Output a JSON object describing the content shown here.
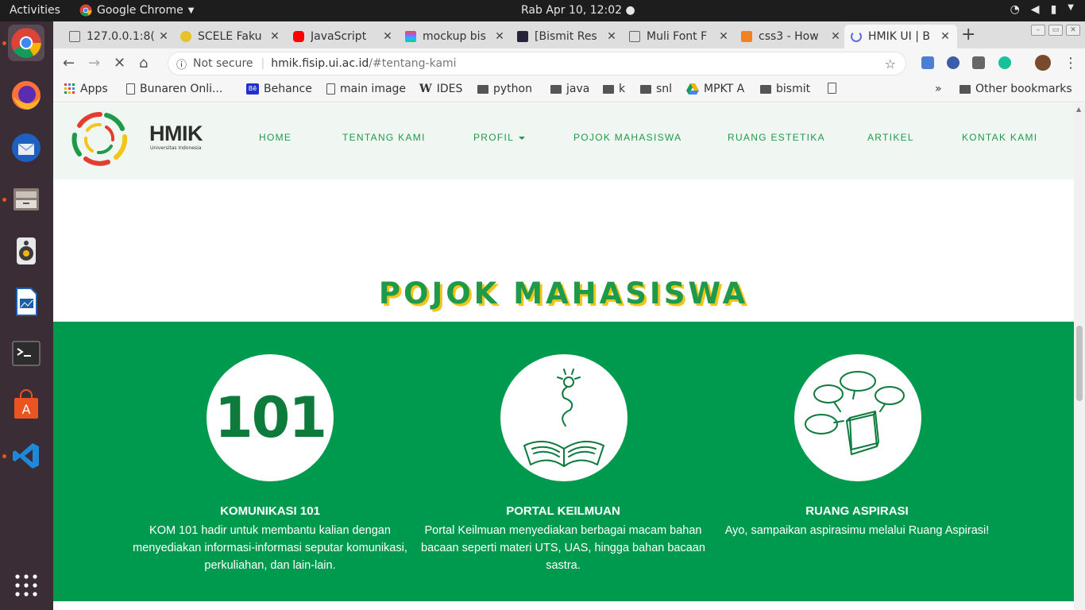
{
  "os": {
    "activities": "Activities",
    "app_name": "Google Chrome",
    "clock": "Rab Apr 10, 12:02 ●"
  },
  "tabs": [
    {
      "title": "127.0.0.1:8(",
      "icon_color": "#666666"
    },
    {
      "title": "SCELE Faku",
      "icon_color": "#e6c229"
    },
    {
      "title": "JavaScript",
      "icon_color": "#ff0000"
    },
    {
      "title": "mockup bis",
      "icon_color": "#a259ff"
    },
    {
      "title": "[Bismit Res",
      "icon_color": "#26233a"
    },
    {
      "title": "Muli Font F",
      "icon_color": "#666666"
    },
    {
      "title": "css3 - How",
      "icon_color": "#f48024"
    },
    {
      "title": "HMIK UI | B",
      "icon_color": "#5b6ee1"
    }
  ],
  "address": {
    "security": "Not secure",
    "host": "hmik.fisip.ui.ac.id",
    "path": "/#tentang-kami"
  },
  "bookmarks": [
    {
      "label": "Apps",
      "kind": "apps"
    },
    {
      "label": "Bunaren Onli...",
      "kind": "page"
    },
    {
      "label": "Behance",
      "kind": "behance"
    },
    {
      "label": "main image",
      "kind": "page"
    },
    {
      "label": "IDES",
      "kind": "wiki"
    },
    {
      "label": "python",
      "kind": "folder"
    },
    {
      "label": "java",
      "kind": "folder"
    },
    {
      "label": "k",
      "kind": "folder"
    },
    {
      "label": "snl",
      "kind": "folder"
    },
    {
      "label": "MPKT A",
      "kind": "drive"
    },
    {
      "label": "bismit",
      "kind": "folder"
    },
    {
      "label": "",
      "kind": "page"
    }
  ],
  "bookmarks_more": "»",
  "other_bookmarks": "Other bookmarks",
  "site": {
    "logo_text": "HMIK",
    "logo_subtext": "Universitas Indonesia",
    "menu": [
      "HOME",
      "TENTANG KAMI",
      "PROFIL",
      "POJOK MAHASISWA",
      "RUANG ESTETIKA",
      "ARTIKEL",
      "KONTAK KAMI"
    ],
    "section_title": "POJOK MAHASISWA",
    "brand_green": "#009a4e",
    "accent_yellow": "#f3c518",
    "cards": [
      {
        "icon_text": "101",
        "title": "KOMUNIKASI 101",
        "desc": "KOM 101 hadir untuk membantu kalian dengan menyediakan informasi-informasi seputar komunikasi, perkuliahan, dan lain-lain."
      },
      {
        "icon_text": "",
        "title": "PORTAL KEILMUAN",
        "desc": "Portal Keilmuan menyediakan berbagai macam bahan bacaan seperti materi UTS, UAS, hingga bahan bacaan sastra."
      },
      {
        "icon_text": "",
        "title": "RUANG ASPIRASI",
        "desc": "Ayo, sampaikan aspirasimu melalui Ruang Aspirasi!"
      }
    ]
  }
}
